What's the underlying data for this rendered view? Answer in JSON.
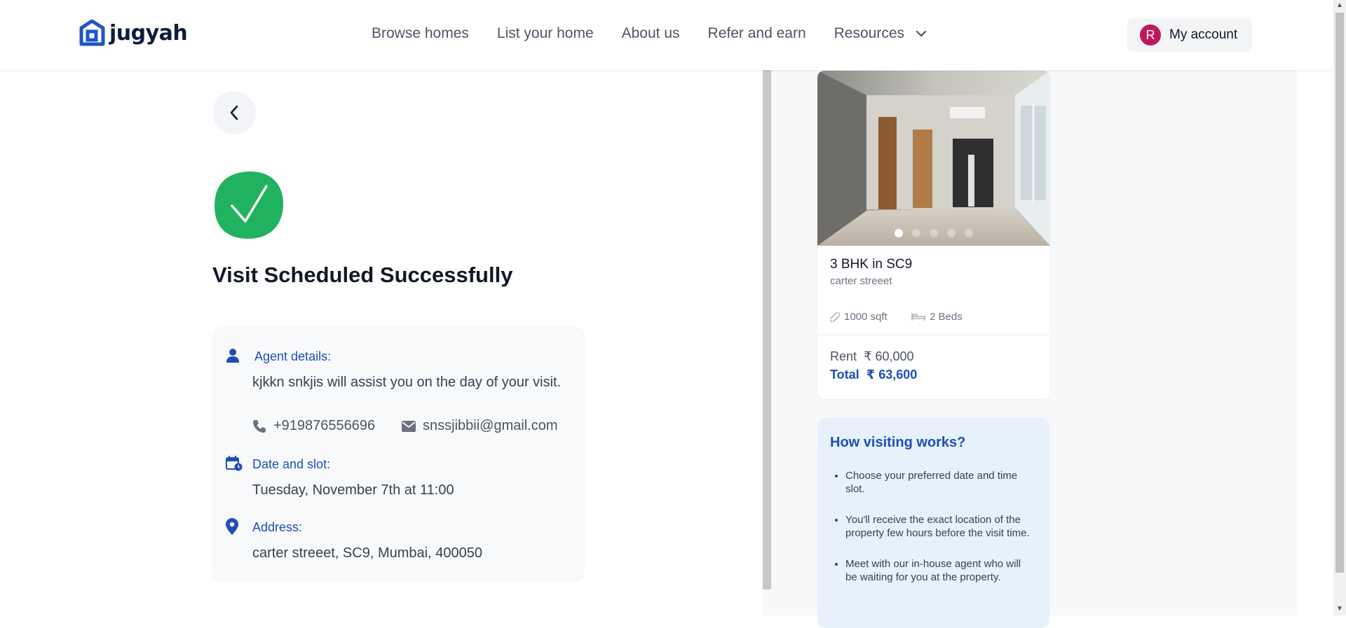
{
  "header": {
    "logo_text": "jugyah",
    "nav": [
      "Browse homes",
      "List your home",
      "About us",
      "Refer and earn",
      "Resources"
    ],
    "account_initial": "R",
    "account_label": "My account"
  },
  "main": {
    "title": "Visit Scheduled Successfully",
    "agent_heading": "Agent details:",
    "agent_text": "kjkkn snkjis will assist you on the day of your visit.",
    "phone": "+919876556696",
    "email": "snssjibbii@gmail.com",
    "date_heading": "Date and slot:",
    "date_text": "Tuesday, November 7th at 11:00",
    "address_heading": "Address:",
    "address_text": "carter streeet, SC9, Mumbai, 400050"
  },
  "property": {
    "title": "3 BHK in SC9",
    "subtitle": "carter streeet",
    "area": "1000 sqft",
    "beds": "2 Beds",
    "rent_label": "Rent",
    "rent_value": "₹ 60,000",
    "total_label": "Total",
    "total_value": "₹ 63,600",
    "photo_count": 5,
    "photo_index": 1
  },
  "how": {
    "title": "How visiting works?",
    "steps": [
      "Choose your preferred date and time slot.",
      "You'll receive the exact location of the property few hours before the visit time.",
      "Meet with our in-house agent who will be waiting for you at the property."
    ]
  },
  "colors": {
    "brand": "#1e4fb3",
    "success": "#21b25f",
    "avatar": "#be185d"
  }
}
